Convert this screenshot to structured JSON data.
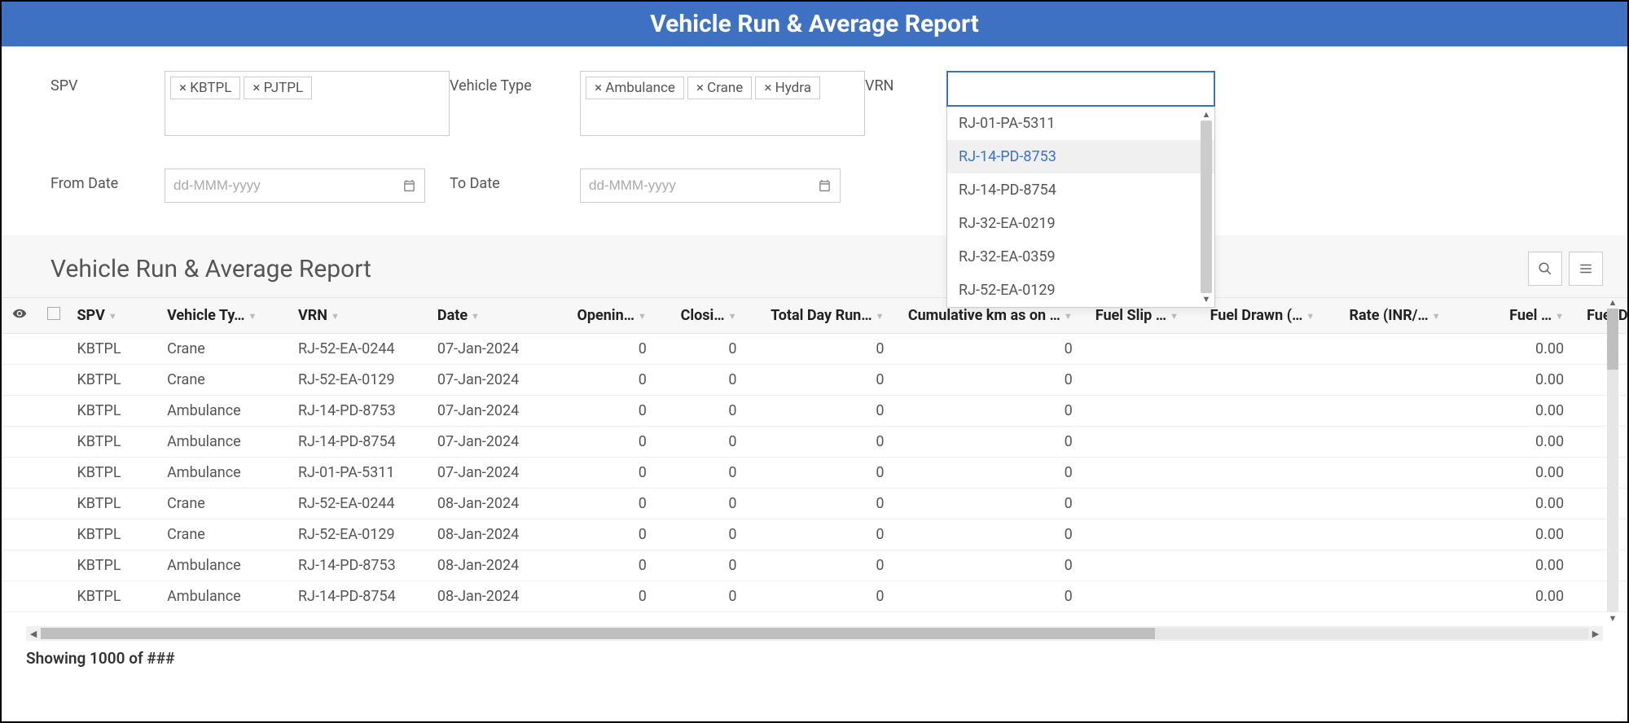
{
  "header": {
    "title": "Vehicle Run & Average Report"
  },
  "filters": {
    "spv": {
      "label": "SPV",
      "tags": [
        "KBTPL",
        "PJTPL"
      ]
    },
    "vehicle_type": {
      "label": "Vehicle Type",
      "tags": [
        "Ambulance",
        "Crane",
        "Hydra"
      ]
    },
    "vrn": {
      "label": "VRN",
      "value": "",
      "options": [
        "RJ-01-PA-5311",
        "RJ-14-PD-8753",
        "RJ-14-PD-8754",
        "RJ-32-EA-0219",
        "RJ-32-EA-0359",
        "RJ-52-EA-0129"
      ],
      "highlight_index": 1
    },
    "from_date": {
      "label": "From Date",
      "placeholder": "dd-MMM-yyyy"
    },
    "to_date": {
      "label": "To Date",
      "placeholder": "dd-MMM-yyyy"
    }
  },
  "report": {
    "title": "Vehicle Run & Average Report",
    "columns": [
      "SPV",
      "Vehicle Ty…",
      "VRN",
      "Date",
      "Openin…",
      "Closi…",
      "Total Day Run…",
      "Cumulative km as on …",
      "Fuel Slip …",
      "Fuel Drawn (…",
      "Rate (INR/…",
      "Fuel …",
      "Fuel D"
    ],
    "rows": [
      {
        "spv": "KBTPL",
        "vt": "Crane",
        "vrn": "RJ-52-EA-0244",
        "date": "07-Jan-2024",
        "open": "0",
        "close": "0",
        "run": "0",
        "cum": "0",
        "slip": "",
        "drawn": "",
        "rate": "",
        "fuel": "0.00"
      },
      {
        "spv": "KBTPL",
        "vt": "Crane",
        "vrn": "RJ-52-EA-0129",
        "date": "07-Jan-2024",
        "open": "0",
        "close": "0",
        "run": "0",
        "cum": "0",
        "slip": "",
        "drawn": "",
        "rate": "",
        "fuel": "0.00"
      },
      {
        "spv": "KBTPL",
        "vt": "Ambulance",
        "vrn": "RJ-14-PD-8753",
        "date": "07-Jan-2024",
        "open": "0",
        "close": "0",
        "run": "0",
        "cum": "0",
        "slip": "",
        "drawn": "",
        "rate": "",
        "fuel": "0.00"
      },
      {
        "spv": "KBTPL",
        "vt": "Ambulance",
        "vrn": "RJ-14-PD-8754",
        "date": "07-Jan-2024",
        "open": "0",
        "close": "0",
        "run": "0",
        "cum": "0",
        "slip": "",
        "drawn": "",
        "rate": "",
        "fuel": "0.00"
      },
      {
        "spv": "KBTPL",
        "vt": "Ambulance",
        "vrn": "RJ-01-PA-5311",
        "date": "07-Jan-2024",
        "open": "0",
        "close": "0",
        "run": "0",
        "cum": "0",
        "slip": "",
        "drawn": "",
        "rate": "",
        "fuel": "0.00"
      },
      {
        "spv": "KBTPL",
        "vt": "Crane",
        "vrn": "RJ-52-EA-0244",
        "date": "08-Jan-2024",
        "open": "0",
        "close": "0",
        "run": "0",
        "cum": "0",
        "slip": "",
        "drawn": "",
        "rate": "",
        "fuel": "0.00"
      },
      {
        "spv": "KBTPL",
        "vt": "Crane",
        "vrn": "RJ-52-EA-0129",
        "date": "08-Jan-2024",
        "open": "0",
        "close": "0",
        "run": "0",
        "cum": "0",
        "slip": "",
        "drawn": "",
        "rate": "",
        "fuel": "0.00"
      },
      {
        "spv": "KBTPL",
        "vt": "Ambulance",
        "vrn": "RJ-14-PD-8753",
        "date": "08-Jan-2024",
        "open": "0",
        "close": "0",
        "run": "0",
        "cum": "0",
        "slip": "",
        "drawn": "",
        "rate": "",
        "fuel": "0.00"
      },
      {
        "spv": "KBTPL",
        "vt": "Ambulance",
        "vrn": "RJ-14-PD-8754",
        "date": "08-Jan-2024",
        "open": "0",
        "close": "0",
        "run": "0",
        "cum": "0",
        "slip": "",
        "drawn": "",
        "rate": "",
        "fuel": "0.00"
      }
    ],
    "footer": "Showing 1000 of ###"
  }
}
